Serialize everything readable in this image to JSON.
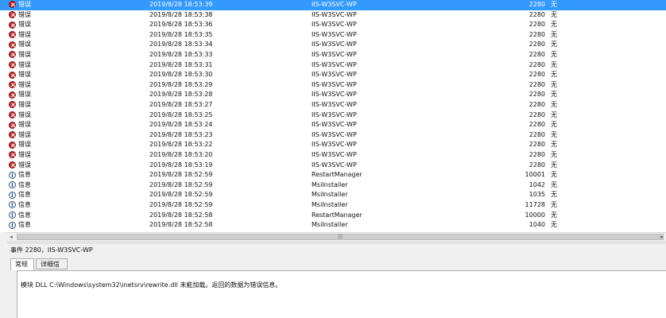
{
  "events": [
    {
      "icon": "error-icon",
      "level": "错误",
      "date": "2019/8/28 18:53:39",
      "source": "IIS-W3SVC-WP",
      "id": "2280",
      "category": "无",
      "selected": true
    },
    {
      "icon": "error-icon",
      "level": "错误",
      "date": "2019/8/28 18:53:38",
      "source": "IIS-W3SVC-WP",
      "id": "2280",
      "category": "无"
    },
    {
      "icon": "error-icon",
      "level": "错误",
      "date": "2019/8/28 18:53:36",
      "source": "IIS-W3SVC-WP",
      "id": "2280",
      "category": "无"
    },
    {
      "icon": "error-icon",
      "level": "错误",
      "date": "2019/8/28 18:53:35",
      "source": "IIS-W3SVC-WP",
      "id": "2280",
      "category": "无"
    },
    {
      "icon": "error-icon",
      "level": "错误",
      "date": "2019/8/28 18:53:34",
      "source": "IIS-W3SVC-WP",
      "id": "2280",
      "category": "无"
    },
    {
      "icon": "error-icon",
      "level": "错误",
      "date": "2019/8/28 18:53:33",
      "source": "IIS-W3SVC-WP",
      "id": "2280",
      "category": "无"
    },
    {
      "icon": "error-icon",
      "level": "错误",
      "date": "2019/8/28 18:53:31",
      "source": "IIS-W3SVC-WP",
      "id": "2280",
      "category": "无"
    },
    {
      "icon": "error-icon",
      "level": "错误",
      "date": "2019/8/28 18:53:30",
      "source": "IIS-W3SVC-WP",
      "id": "2280",
      "category": "无"
    },
    {
      "icon": "error-icon",
      "level": "错误",
      "date": "2019/8/28 18:53:29",
      "source": "IIS-W3SVC-WP",
      "id": "2280",
      "category": "无"
    },
    {
      "icon": "error-icon",
      "level": "错误",
      "date": "2019/8/28 18:53:28",
      "source": "IIS-W3SVC-WP",
      "id": "2280",
      "category": "无"
    },
    {
      "icon": "error-icon",
      "level": "错误",
      "date": "2019/8/28 18:53:27",
      "source": "IIS-W3SVC-WP",
      "id": "2280",
      "category": "无"
    },
    {
      "icon": "error-icon",
      "level": "错误",
      "date": "2019/8/28 18:53:25",
      "source": "IIS-W3SVC-WP",
      "id": "2280",
      "category": "无"
    },
    {
      "icon": "error-icon",
      "level": "错误",
      "date": "2019/8/28 18:53:24",
      "source": "IIS-W3SVC-WP",
      "id": "2280",
      "category": "无"
    },
    {
      "icon": "error-icon",
      "level": "错误",
      "date": "2019/8/28 18:53:23",
      "source": "IIS-W3SVC-WP",
      "id": "2280",
      "category": "无"
    },
    {
      "icon": "error-icon",
      "level": "错误",
      "date": "2019/8/28 18:53:22",
      "source": "IIS-W3SVC-WP",
      "id": "2280",
      "category": "无"
    },
    {
      "icon": "error-icon",
      "level": "错误",
      "date": "2019/8/28 18:53:20",
      "source": "IIS-W3SVC-WP",
      "id": "2280",
      "category": "无"
    },
    {
      "icon": "error-icon",
      "level": "错误",
      "date": "2019/8/28 18:53:19",
      "source": "IIS-W3SVC-WP",
      "id": "2280",
      "category": "无"
    },
    {
      "icon": "info-icon",
      "level": "信息",
      "date": "2019/8/28 18:52:59",
      "source": "RestartManager",
      "id": "10001",
      "category": "无"
    },
    {
      "icon": "info-icon",
      "level": "信息",
      "date": "2019/8/28 18:52:59",
      "source": "MsiInstaller",
      "id": "1042",
      "category": "无"
    },
    {
      "icon": "info-icon",
      "level": "信息",
      "date": "2019/8/28 18:52:59",
      "source": "MsiInstaller",
      "id": "1035",
      "category": "无"
    },
    {
      "icon": "info-icon",
      "level": "信息",
      "date": "2019/8/28 18:52:59",
      "source": "MsiInstaller",
      "id": "11728",
      "category": "无"
    },
    {
      "icon": "info-icon",
      "level": "信息",
      "date": "2019/8/28 18:52:58",
      "source": "RestartManager",
      "id": "10000",
      "category": "无"
    },
    {
      "icon": "info-icon",
      "level": "信息",
      "date": "2019/8/28 18:52:58",
      "source": "MsiInstaller",
      "id": "1040",
      "category": "无"
    }
  ],
  "scrollbar": {
    "left_arrow": "◂",
    "right_arrow": "▸",
    "grip": "|||"
  },
  "detail": {
    "title": "事件 2280，IIS-W3SVC-WP",
    "tabs": [
      {
        "label": "常规"
      },
      {
        "label": "详细信息"
      }
    ],
    "message": "模块 DLL C:\\Windows\\system32\\inetsrv\\rewrite.dll 未能加载。返回的数据为错误信息。"
  }
}
